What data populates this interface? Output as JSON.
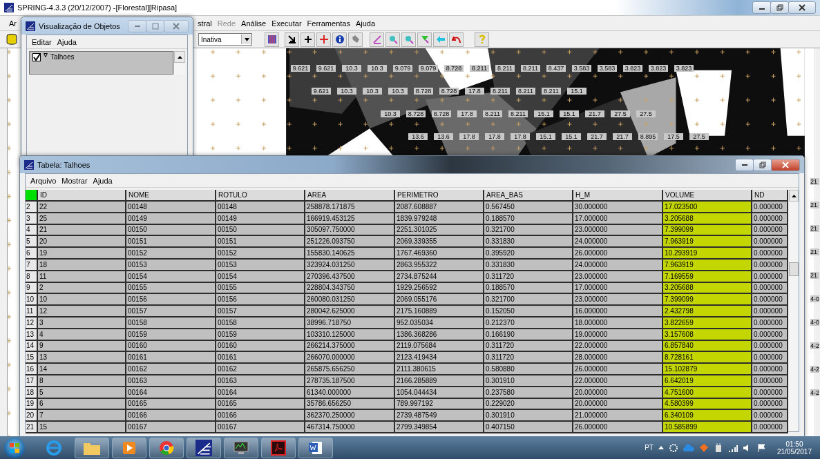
{
  "main_window": {
    "title": "SPRING-4.3.3 (20/12/2007) -[Florestal][Ripasa]",
    "menu": [
      {
        "label": "Ar",
        "disabled": false
      },
      {
        "label": "stral",
        "disabled": false
      },
      {
        "label": "Rede",
        "disabled": true
      },
      {
        "label": "Análise",
        "disabled": false
      },
      {
        "label": "Executar",
        "disabled": false
      },
      {
        "label": "Ferramentas",
        "disabled": false
      },
      {
        "label": "Ajuda",
        "disabled": false
      }
    ],
    "toolbar": {
      "mode_select": "Inativa"
    }
  },
  "map": {
    "label_rows": [
      [
        "9.621",
        "9.621",
        "10.3",
        "10.3",
        "9.079",
        "9.079",
        "8.728",
        "8.211",
        "8.211",
        "8.211",
        "8.437",
        "3.583",
        "3.583",
        "3.823",
        "3.823",
        "3.823"
      ],
      [
        "9.621",
        "10.3",
        "10.3",
        "10.3",
        "8.728",
        "8.728",
        "17.8",
        "8.211",
        "8.211",
        "8.211",
        "15.1"
      ],
      [
        "10.3",
        "8.728",
        "8.728",
        "17.8",
        "8.211",
        "8.211",
        "15.1",
        "15.1",
        "21.7",
        "27.5",
        "27.5"
      ],
      [
        "13.6",
        "13.6",
        "17.8",
        "17.8",
        "17.8",
        "15.1",
        "15.1",
        "21.7",
        "21.7",
        "8.895",
        "17.5",
        "27.5"
      ]
    ],
    "edge_labels": [
      "21",
      "21",
      "21",
      "21",
      "21",
      "4-0",
      "4-0",
      "4-2",
      "4-2",
      "4-2"
    ]
  },
  "object_window": {
    "title": "Visualização de Objetos",
    "menu": [
      "Editar",
      "Ajuda"
    ],
    "items": [
      {
        "label": "Talhoes",
        "checked": true
      }
    ]
  },
  "table_window": {
    "title": "Tabela: Talhoes",
    "menu": [
      "Arquivo",
      "Mostrar",
      "Ajuda"
    ],
    "columns": [
      {
        "label": "ID",
        "selected": false
      },
      {
        "label": "NOME",
        "selected": false
      },
      {
        "label": "ROTULO",
        "selected": false
      },
      {
        "label": "AREA",
        "selected": false
      },
      {
        "label": "PERIMETRO",
        "selected": false
      },
      {
        "label": "AREA_BAS",
        "selected": false
      },
      {
        "label": "H_M",
        "selected": false
      },
      {
        "label": "VOLUME",
        "selected": true
      },
      {
        "label": "ND",
        "selected": false
      }
    ],
    "rows": [
      {
        "number": "2",
        "cells": [
          "22",
          "00148",
          "00148",
          "258878.171875",
          "2087.608887",
          "0.567450",
          "30.000000",
          "17.023500",
          "0.000000"
        ]
      },
      {
        "number": "3",
        "cells": [
          "25",
          "00149",
          "00149",
          "166919.453125",
          "1839.979248",
          "0.188570",
          "17.000000",
          "3.205688",
          "0.000000"
        ]
      },
      {
        "number": "4",
        "cells": [
          "21",
          "00150",
          "00150",
          "305097.750000",
          "2251.301025",
          "0.321700",
          "23.000000",
          "7.399099",
          "0.000000"
        ]
      },
      {
        "number": "5",
        "cells": [
          "20",
          "00151",
          "00151",
          "251226.093750",
          "2069.339355",
          "0.331830",
          "24.000000",
          "7.963919",
          "0.000000"
        ]
      },
      {
        "number": "6",
        "cells": [
          "19",
          "00152",
          "00152",
          "155830.140625",
          "1767.469360",
          "0.395920",
          "26.000000",
          "10.293919",
          "0.000000"
        ]
      },
      {
        "number": "7",
        "cells": [
          "18",
          "00153",
          "00153",
          "323924.031250",
          "2863.955322",
          "0.331830",
          "24.000000",
          "7.963919",
          "0.000000"
        ]
      },
      {
        "number": "8",
        "cells": [
          "11",
          "00154",
          "00154",
          "270396.437500",
          "2734.875244",
          "0.311720",
          "23.000000",
          "7.169559",
          "0.000000"
        ]
      },
      {
        "number": "9",
        "cells": [
          "2",
          "00155",
          "00155",
          "228804.343750",
          "1929.256592",
          "0.188570",
          "17.000000",
          "3.205688",
          "0.000000"
        ]
      },
      {
        "number": "10",
        "cells": [
          "10",
          "00156",
          "00156",
          "260080.031250",
          "2069.055176",
          "0.321700",
          "23.000000",
          "7.399099",
          "0.000000"
        ]
      },
      {
        "number": "11",
        "cells": [
          "12",
          "00157",
          "00157",
          "280042.625000",
          "2175.160889",
          "0.152050",
          "16.000000",
          "2.432798",
          "0.000000"
        ]
      },
      {
        "number": "12",
        "cells": [
          "3",
          "00158",
          "00158",
          "38996.718750",
          "952.035034",
          "0.212370",
          "18.000000",
          "3.822659",
          "0.000000"
        ]
      },
      {
        "number": "13",
        "cells": [
          "4",
          "00159",
          "00159",
          "103310.125000",
          "1386.368286",
          "0.166190",
          "19.000000",
          "3.157608",
          "0.000000"
        ]
      },
      {
        "number": "14",
        "cells": [
          "9",
          "00160",
          "00160",
          "266214.375000",
          "2119.075684",
          "0.311720",
          "22.000000",
          "6.857840",
          "0.000000"
        ]
      },
      {
        "number": "15",
        "cells": [
          "13",
          "00161",
          "00161",
          "266070.000000",
          "2123.419434",
          "0.311720",
          "28.000000",
          "8.728161",
          "0.000000"
        ]
      },
      {
        "number": "16",
        "cells": [
          "14",
          "00162",
          "00162",
          "265875.656250",
          "2111.380615",
          "0.580880",
          "26.000000",
          "15.102879",
          "0.000000"
        ]
      },
      {
        "number": "17",
        "cells": [
          "8",
          "00163",
          "00163",
          "278735.187500",
          "2166.285889",
          "0.301910",
          "22.000000",
          "6.642019",
          "0.000000"
        ]
      },
      {
        "number": "18",
        "cells": [
          "5",
          "00164",
          "00164",
          "61340.000000",
          "1054.044434",
          "0.237580",
          "20.000000",
          "4.751600",
          "0.000000"
        ]
      },
      {
        "number": "19",
        "cells": [
          "6",
          "00165",
          "00165",
          "35786.656250",
          "789.997192",
          "0.229020",
          "20.000000",
          "4.580399",
          "0.000000"
        ]
      },
      {
        "number": "20",
        "cells": [
          "7",
          "00166",
          "00166",
          "362370.250000",
          "2739.487549",
          "0.301910",
          "21.000000",
          "6.340109",
          "0.000000"
        ]
      },
      {
        "number": "21",
        "cells": [
          "15",
          "00167",
          "00167",
          "467314.750000",
          "2799.349854",
          "0.407150",
          "26.000000",
          "10.585899",
          "0.000000"
        ]
      }
    ]
  },
  "taskbar": {
    "language": "PT",
    "time": "01:50",
    "date": "21/05/2017"
  }
}
